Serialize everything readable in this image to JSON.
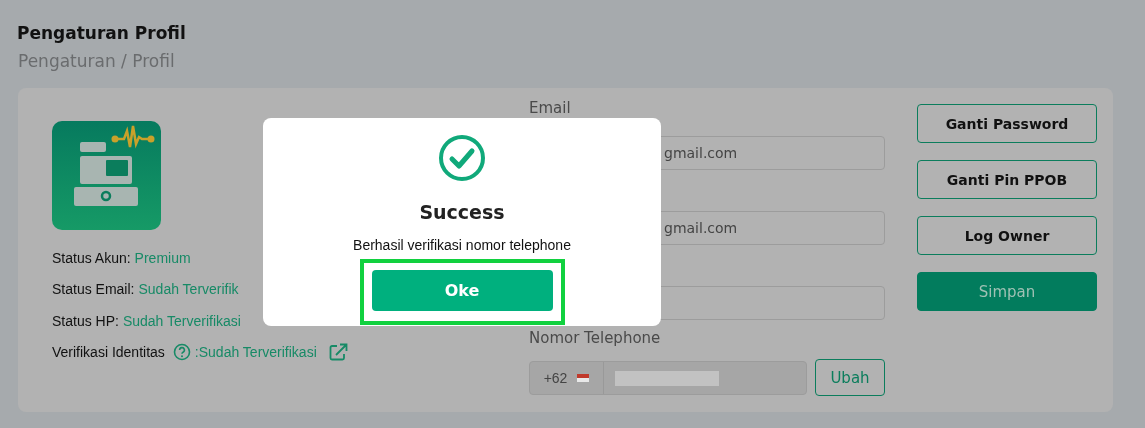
{
  "page": {
    "title": "Pengaturan Profil",
    "breadcrumb": "Pengaturan / Profil"
  },
  "profile": {
    "statuses": [
      {
        "kind": "plain",
        "label": "Status Akun:",
        "value": "Premium"
      },
      {
        "kind": "plain",
        "label": "Status Email:",
        "value": "Sudah Terverifik"
      },
      {
        "kind": "plain",
        "label": "Status HP:",
        "value": "Sudah Terverifikasi"
      },
      {
        "kind": "identity",
        "label": "Verifikasi Identitas",
        "value": ":Sudah Terverifikasi"
      }
    ]
  },
  "form": {
    "fields": [
      {
        "kind": "text",
        "label": "Email",
        "value": "gmail.com"
      },
      {
        "kind": "text",
        "value": "gmail.com"
      },
      {
        "kind": "text"
      },
      {
        "kind": "phone",
        "label": "Nomor Telephone",
        "prefix": "+62",
        "button": "Ubah"
      }
    ]
  },
  "actions": [
    {
      "kind": "outline",
      "label": "Ganti Password"
    },
    {
      "kind": "outline",
      "label": "Ganti Pin PPOB"
    },
    {
      "kind": "outline",
      "label": "Log Owner"
    },
    {
      "kind": "primary",
      "label": "Simpan"
    }
  ],
  "dialog": {
    "title": "Success",
    "message": "Berhasil verifikasi nomor telephone",
    "button": "Oke",
    "highlighted": true
  }
}
